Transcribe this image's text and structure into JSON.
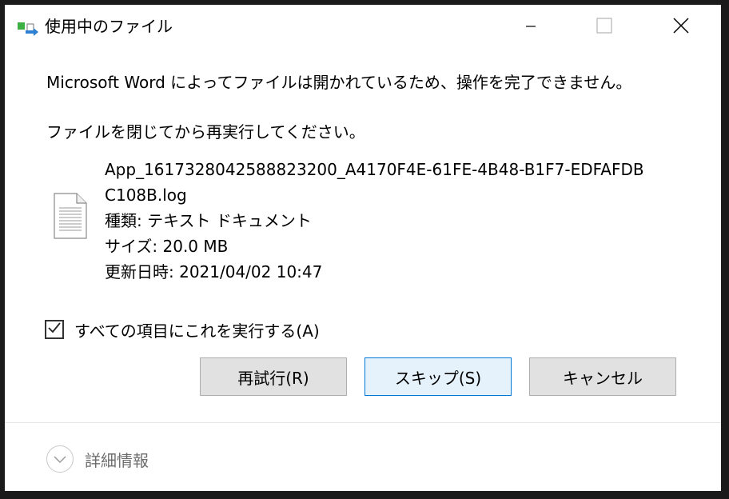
{
  "window": {
    "title": "使用中のファイル"
  },
  "message": {
    "main": "Microsoft Word によってファイルは開かれているため、操作を完了できません。",
    "sub": "ファイルを閉じてから再実行してください。"
  },
  "file": {
    "name_line1": "App_1617328042588823200_A4170F4E-61FE-4B48-B1F7-EDFAFDB",
    "name_line2": "C108B.log",
    "type": "種類: テキスト ドキュメント",
    "size": "サイズ: 20.0 MB",
    "modified": "更新日時: 2021/04/02 10:47"
  },
  "checkbox": {
    "label": "すべての項目にこれを実行する(A)",
    "checked": true
  },
  "buttons": {
    "retry": "再試行(R)",
    "skip": "スキップ(S)",
    "cancel": "キャンセル"
  },
  "details": {
    "label": "詳細情報"
  },
  "icons": {
    "title": "file-move-icon",
    "minimize": "minimize-icon",
    "maximize": "maximize-icon",
    "close": "close-icon",
    "file": "text-document-icon",
    "checkbox": "checkmark-icon",
    "details": "chevron-down-icon"
  },
  "colors": {
    "default_button_border": "#0078d7",
    "default_button_bg": "#e5f1fb",
    "button_bg": "#e1e1e1"
  }
}
